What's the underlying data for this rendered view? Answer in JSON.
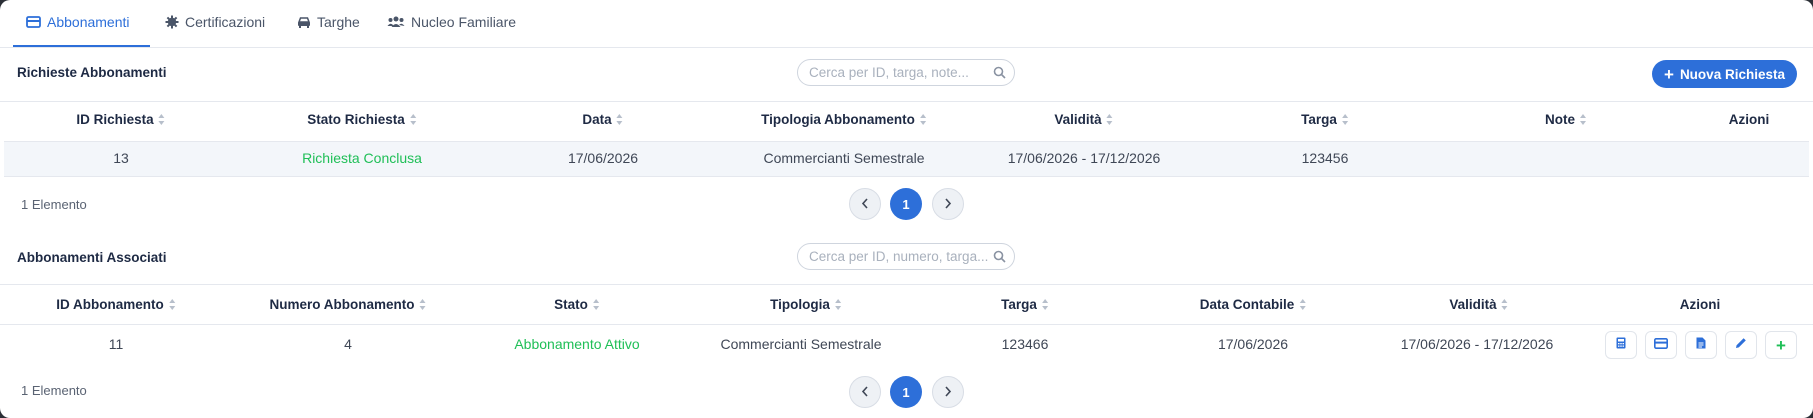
{
  "tabs": [
    {
      "label": "Abbonamenti",
      "icon": "card-icon",
      "active": true
    },
    {
      "label": "Certificazioni",
      "icon": "certificate-icon",
      "active": false
    },
    {
      "label": "Targhe",
      "icon": "car-icon",
      "active": false
    },
    {
      "label": "Nucleo Familiare",
      "icon": "users-icon",
      "active": false
    }
  ],
  "requests": {
    "title": "Richieste Abbonamenti",
    "search_placeholder": "Cerca per ID, targa, note...",
    "new_button": "Nuova Richiesta",
    "columns": [
      "ID Richiesta",
      "Stato Richiesta",
      "Data",
      "Tipologia Abbonamento",
      "Validità",
      "Targa",
      "Note",
      "Azioni"
    ],
    "rows": [
      {
        "id": "13",
        "stato": "Richiesta Conclusa",
        "data": "17/06/2026",
        "tipologia": "Commercianti Semestrale",
        "validita": "17/06/2026 - 17/12/2026",
        "targa": "123456",
        "note": ""
      }
    ],
    "count": "1 Elemento",
    "page": "1"
  },
  "associated": {
    "title": "Abbonamenti Associati",
    "search_placeholder": "Cerca per ID, numero, targa...",
    "columns": [
      "ID Abbonamento",
      "Numero Abbonamento",
      "Stato",
      "Tipologia",
      "Targa",
      "Data Contabile",
      "Validità",
      "Azioni"
    ],
    "rows": [
      {
        "id": "11",
        "numero": "4",
        "stato": "Abbonamento Attivo",
        "tipologia": "Commercianti Semestrale",
        "targa": "123466",
        "data_contabile": "17/06/2026",
        "validita": "17/06/2026 - 17/12/2026"
      }
    ],
    "actions": [
      "calculator-icon",
      "card-icon",
      "document-icon",
      "pencil-icon",
      "plus-icon"
    ],
    "count": "1 Elemento",
    "page": "1"
  },
  "colors": {
    "accent": "#2d6fd9",
    "success": "#1fbf57"
  }
}
